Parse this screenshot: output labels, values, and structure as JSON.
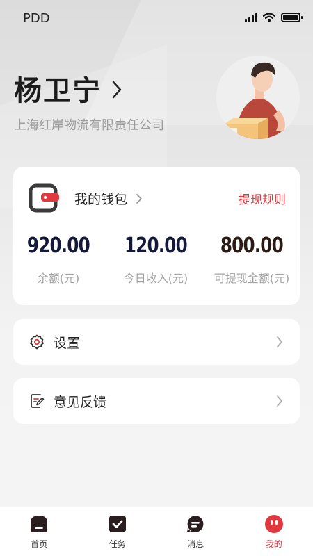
{
  "status_bar": {
    "carrier": "PDD"
  },
  "profile": {
    "name": "杨卫宁",
    "company": "上海红岸物流有限责任公司"
  },
  "wallet": {
    "title": "我的钱包",
    "rule_link": "提现规则",
    "stats": [
      {
        "value": "920.00",
        "label": "余额(元)"
      },
      {
        "value": "120.00",
        "label": "今日收入(元)"
      },
      {
        "value": "800.00",
        "label": "可提现金额(元)"
      }
    ]
  },
  "menu": {
    "settings": "设置",
    "feedback": "意见反馈"
  },
  "tabs": [
    {
      "label": "首页",
      "icon": "home-icon"
    },
    {
      "label": "任务",
      "icon": "task-icon"
    },
    {
      "label": "消息",
      "icon": "message-icon"
    },
    {
      "label": "我的",
      "icon": "profile-icon",
      "active": true
    }
  ],
  "colors": {
    "accent": "#e0383e",
    "value_dark": "#14193a",
    "value_brown": "#2a1a14"
  }
}
